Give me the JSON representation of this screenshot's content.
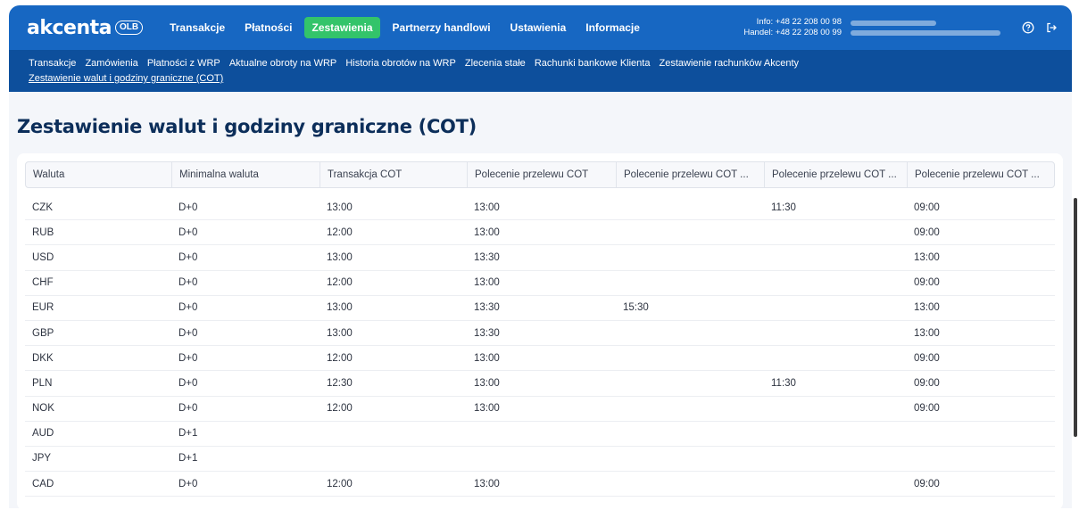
{
  "brand": {
    "word": "akcenta",
    "badge": "OLB"
  },
  "main_nav": [
    {
      "label": "Transakcje",
      "active": false
    },
    {
      "label": "Płatności",
      "active": false
    },
    {
      "label": "Zestawienia",
      "active": true
    },
    {
      "label": "Partnerzy handlowi",
      "active": false
    },
    {
      "label": "Ustawienia",
      "active": false
    },
    {
      "label": "Informacje",
      "active": false
    }
  ],
  "contact": {
    "info": "Info: +48 22 208 00 98",
    "trade": "Handel: +48 22 208 00 99"
  },
  "icons": {
    "help": "help-circle-icon",
    "logout": "logout-icon"
  },
  "sub_nav": [
    {
      "label": "Transakcje"
    },
    {
      "label": "Zamówienia"
    },
    {
      "label": "Płatności z WRP"
    },
    {
      "label": "Aktualne obroty na WRP"
    },
    {
      "label": "Historia obrotów na WRP"
    },
    {
      "label": "Zlecenia stałe"
    },
    {
      "label": "Rachunki bankowe Klienta"
    },
    {
      "label": "Zestawienie rachunków Akcenty"
    },
    {
      "label": "Zestawienie walut i godziny graniczne (COT)",
      "active": true
    }
  ],
  "page_title": "Zestawienie walut i godziny graniczne (COT)",
  "table": {
    "columns": [
      "Waluta",
      "Minimalna waluta",
      "Transakcja COT",
      "Polecenie przelewu COT",
      "Polecenie przelewu COT ...",
      "Polecenie przelewu COT ...",
      "Polecenie przelewu COT ..."
    ],
    "rows": [
      [
        "CZK",
        "D+0",
        "13:00",
        "13:00",
        "",
        "11:30",
        "09:00"
      ],
      [
        "RUB",
        "D+0",
        "12:00",
        "13:00",
        "",
        "",
        "09:00"
      ],
      [
        "USD",
        "D+0",
        "13:00",
        "13:30",
        "",
        "",
        "13:00"
      ],
      [
        "CHF",
        "D+0",
        "12:00",
        "13:00",
        "",
        "",
        "09:00"
      ],
      [
        "EUR",
        "D+0",
        "13:00",
        "13:30",
        "15:30",
        "",
        "13:00"
      ],
      [
        "GBP",
        "D+0",
        "13:00",
        "13:30",
        "",
        "",
        "13:00"
      ],
      [
        "DKK",
        "D+0",
        "12:00",
        "13:00",
        "",
        "",
        "09:00"
      ],
      [
        "PLN",
        "D+0",
        "12:30",
        "13:00",
        "",
        "11:30",
        "09:00"
      ],
      [
        "NOK",
        "D+0",
        "12:00",
        "13:00",
        "",
        "",
        "09:00"
      ],
      [
        "AUD",
        "D+1",
        "",
        "",
        "",
        "",
        ""
      ],
      [
        "JPY",
        "D+1",
        "",
        "",
        "",
        "",
        ""
      ],
      [
        "CAD",
        "D+0",
        "12:00",
        "13:00",
        "",
        "",
        "09:00"
      ]
    ]
  },
  "colors": {
    "topbar": "#1767c2",
    "subnav": "#0d4f9c",
    "active_tab": "#33c46a",
    "title": "#0c2e5a"
  }
}
